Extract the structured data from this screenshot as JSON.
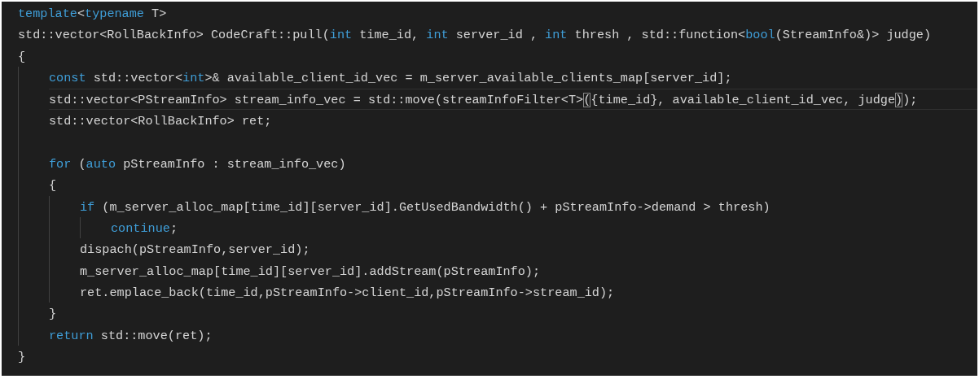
{
  "editor": {
    "lines": [
      {
        "kind": "line",
        "current": false,
        "tokens": [
          {
            "kind": "keyword",
            "text": "template"
          },
          {
            "kind": "plain",
            "text": "<"
          },
          {
            "kind": "keyword",
            "text": "typename"
          },
          {
            "kind": "plain",
            "text": " T>"
          }
        ]
      },
      {
        "kind": "line",
        "current": false,
        "tokens": [
          {
            "kind": "plain",
            "text": "std::vector<RollBackInfo> CodeCraft::pull("
          },
          {
            "kind": "keyword",
            "text": "int"
          },
          {
            "kind": "plain",
            "text": " time_id, "
          },
          {
            "kind": "keyword",
            "text": "int"
          },
          {
            "kind": "plain",
            "text": " server_id , "
          },
          {
            "kind": "keyword",
            "text": "int"
          },
          {
            "kind": "plain",
            "text": " thresh , std::function<"
          },
          {
            "kind": "keyword",
            "text": "bool"
          },
          {
            "kind": "plain",
            "text": "(StreamInfo&)> judge)"
          }
        ]
      },
      {
        "kind": "line",
        "current": false,
        "tokens": [
          {
            "kind": "plain",
            "text": "{"
          }
        ]
      },
      {
        "kind": "block",
        "children": [
          {
            "kind": "line",
            "current": false,
            "tokens": [
              {
                "kind": "keyword",
                "text": "const"
              },
              {
                "kind": "plain",
                "text": " std::vector<"
              },
              {
                "kind": "keyword",
                "text": "int"
              },
              {
                "kind": "plain",
                "text": ">& available_client_id_vec = m_server_available_clients_map[server_id];"
              }
            ]
          },
          {
            "kind": "line",
            "current": true,
            "tokens": [
              {
                "kind": "plain",
                "text": "std::vector<PStreamInfo> stream_info_vec = std::move(streamInfoFilter<T>"
              },
              {
                "kind": "matched_bracket",
                "text": "("
              },
              {
                "kind": "plain",
                "text": "{time_id}, available_client_id_vec, judge"
              },
              {
                "kind": "matched_bracket",
                "text": ")"
              },
              {
                "kind": "plain",
                "text": ");"
              }
            ]
          },
          {
            "kind": "line",
            "current": false,
            "tokens": [
              {
                "kind": "plain",
                "text": "std::vector<RollBackInfo> ret;"
              }
            ]
          },
          {
            "kind": "blank"
          },
          {
            "kind": "line",
            "current": false,
            "tokens": [
              {
                "kind": "keyword",
                "text": "for"
              },
              {
                "kind": "plain",
                "text": " ("
              },
              {
                "kind": "keyword",
                "text": "auto"
              },
              {
                "kind": "plain",
                "text": " pStreamInfo : stream_info_vec)"
              }
            ]
          },
          {
            "kind": "line",
            "current": false,
            "tokens": [
              {
                "kind": "plain",
                "text": "{"
              }
            ]
          },
          {
            "kind": "block",
            "children": [
              {
                "kind": "line",
                "current": false,
                "tokens": [
                  {
                    "kind": "keyword",
                    "text": "if"
                  },
                  {
                    "kind": "plain",
                    "text": " (m_server_alloc_map[time_id][server_id].GetUsedBandwidth() + pStreamInfo->demand > thresh)"
                  }
                ]
              },
              {
                "kind": "block",
                "children": [
                  {
                    "kind": "line",
                    "current": false,
                    "tokens": [
                      {
                        "kind": "keyword",
                        "text": "continue"
                      },
                      {
                        "kind": "plain",
                        "text": ";"
                      }
                    ]
                  }
                ]
              },
              {
                "kind": "line",
                "current": false,
                "tokens": [
                  {
                    "kind": "plain",
                    "text": "dispach(pStreamInfo,server_id);"
                  }
                ]
              },
              {
                "kind": "line",
                "current": false,
                "tokens": [
                  {
                    "kind": "plain",
                    "text": "m_server_alloc_map[time_id][server_id].addStream(pStreamInfo);"
                  }
                ]
              },
              {
                "kind": "line",
                "current": false,
                "tokens": [
                  {
                    "kind": "plain",
                    "text": "ret.emplace_back(time_id,pStreamInfo->client_id,pStreamInfo->stream_id);"
                  }
                ]
              }
            ]
          },
          {
            "kind": "line",
            "current": false,
            "tokens": [
              {
                "kind": "plain",
                "text": "}"
              }
            ]
          },
          {
            "kind": "line",
            "current": false,
            "tokens": [
              {
                "kind": "keyword",
                "text": "return"
              },
              {
                "kind": "plain",
                "text": " std::move(ret);"
              }
            ]
          }
        ]
      },
      {
        "kind": "line",
        "current": false,
        "tokens": [
          {
            "kind": "plain",
            "text": "}"
          }
        ]
      }
    ]
  }
}
